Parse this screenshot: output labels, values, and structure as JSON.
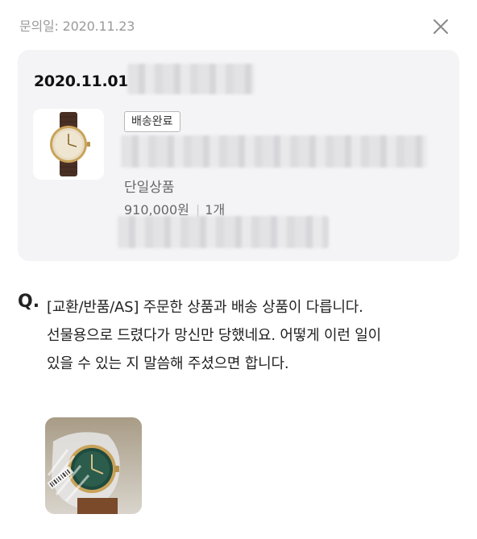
{
  "header": {
    "inquiry_date": "문의일: 2020.11.23",
    "close_icon": "close-icon"
  },
  "order": {
    "order_date": "2020.11.01",
    "status_badge": "배송완료",
    "product_type": "단일상품",
    "price": "910,000원",
    "quantity": "1개",
    "thumbnail_icon": "watch-image"
  },
  "question": {
    "prefix": "Q.",
    "text": "[교환/반품/AS] 주문한 상품과 배송 상품이 다릅니다. 선물용으로 드렸다가 망신만 당했네요. 어떻게 이런 일이 있을 수 있는 지 말씀해 주셨으면 합니다.",
    "attachment_icon": "attached-photo"
  }
}
